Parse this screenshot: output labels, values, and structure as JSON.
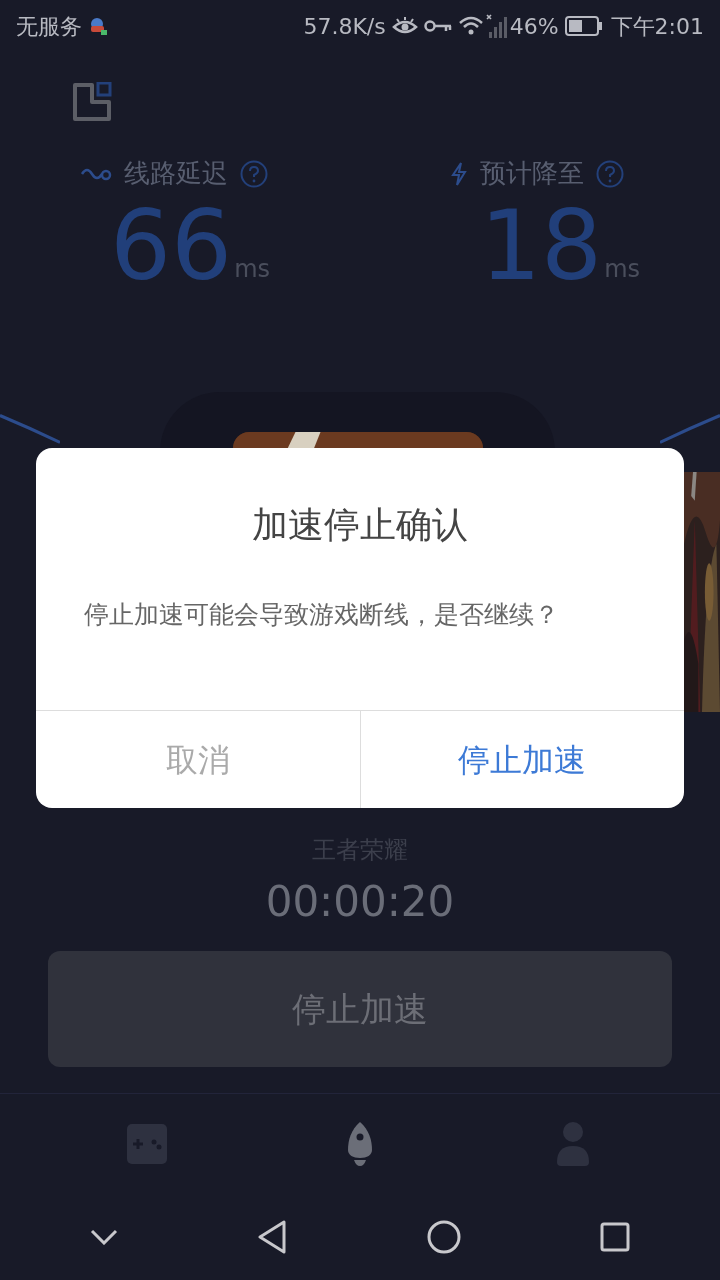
{
  "status_bar": {
    "carrier": "无服务",
    "speed": "57.8K/s",
    "battery": "46%",
    "time": "下午2:01"
  },
  "stats": [
    {
      "kind": "latency",
      "label": "线路延迟",
      "value": "66",
      "unit": "ms"
    },
    {
      "kind": "predicted",
      "label": "预计降至",
      "value": "18",
      "unit": "ms"
    }
  ],
  "game": {
    "name": "王者荣耀",
    "timer": "00:00:20"
  },
  "stop_button": "停止加速",
  "bottom_nav": [
    {
      "kind": "games",
      "selected": false
    },
    {
      "kind": "boost",
      "selected": true
    },
    {
      "kind": "profile",
      "selected": false
    }
  ],
  "dialog": {
    "title": "加速停止确认",
    "message": "停止加速可能会导致游戏断线，是否继续？",
    "buttons": [
      {
        "kind": "cancel",
        "label": "取消"
      },
      {
        "kind": "confirm",
        "label": "停止加速"
      }
    ]
  }
}
